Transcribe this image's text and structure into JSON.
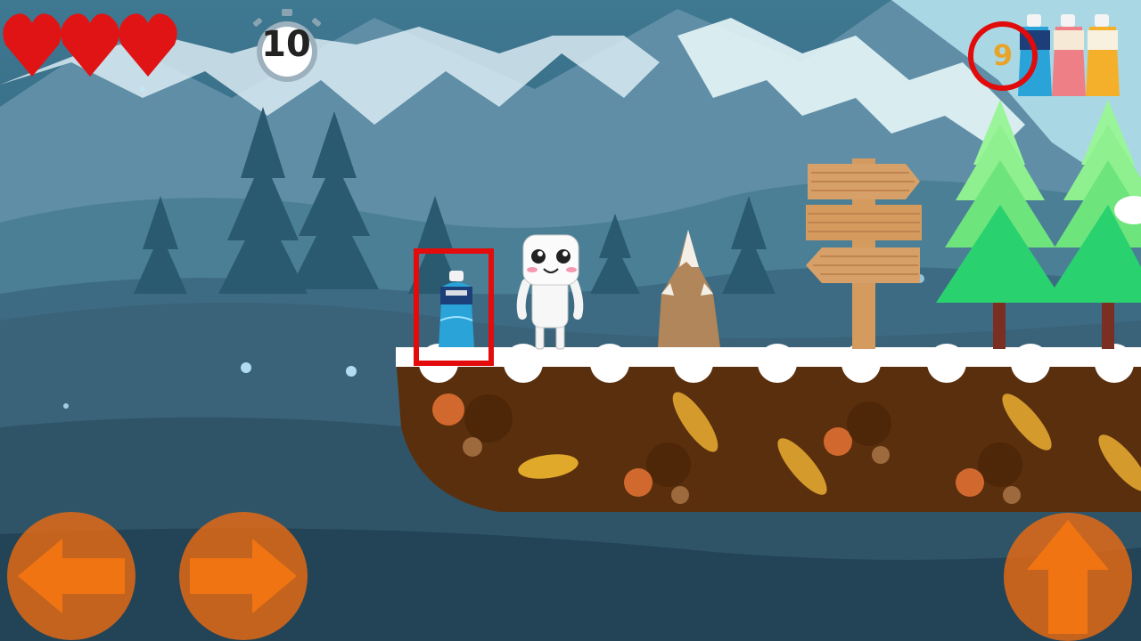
{
  "hud": {
    "lives": 3,
    "timer_value": "10",
    "bottle_count": "9"
  },
  "controls": {
    "left_button": "move-left",
    "right_button": "move-right",
    "jump_button": "jump"
  },
  "colors": {
    "sky": "#2e5a72",
    "ground_dirt": "#5a2f0e",
    "snow": "#ffffff",
    "button_orange": "#e86a12",
    "heart_red": "#e01414",
    "highlight_red": "#e30b0b",
    "score_text": "#e8a42a"
  }
}
